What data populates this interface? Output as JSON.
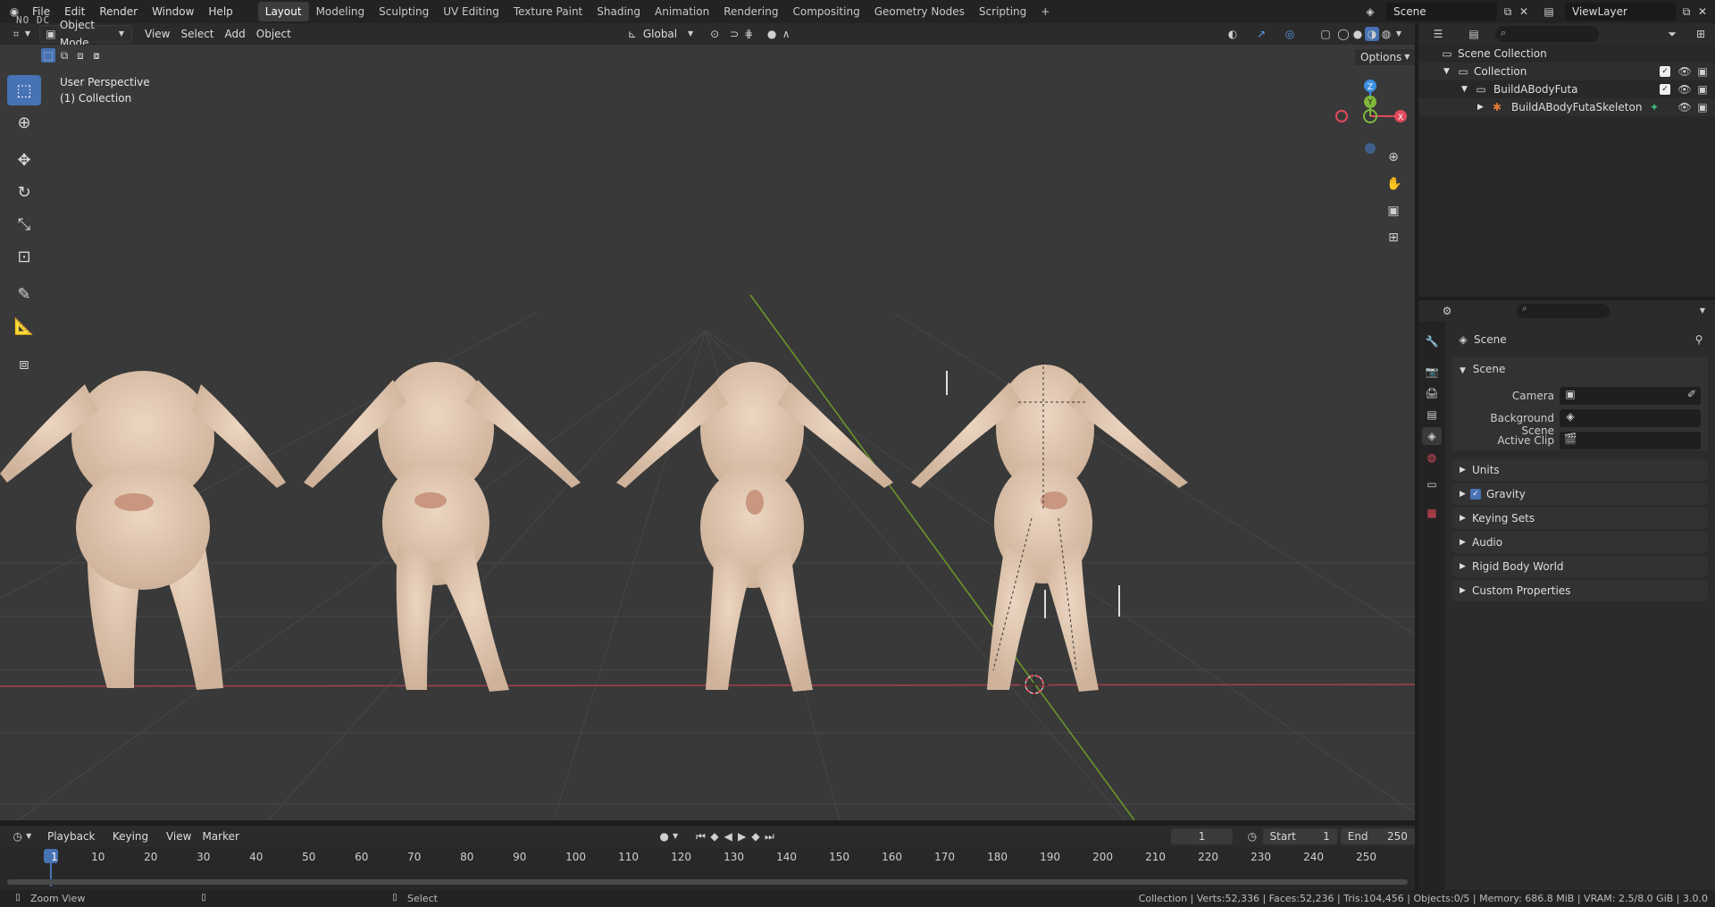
{
  "topbar": {
    "menus": [
      "File",
      "Edit",
      "Render",
      "Window",
      "Help"
    ],
    "workspaces": [
      "Layout",
      "Modeling",
      "Sculpting",
      "UV Editing",
      "Texture Paint",
      "Shading",
      "Animation",
      "Rendering",
      "Compositing",
      "Geometry Nodes",
      "Scripting"
    ],
    "active_workspace": "Layout",
    "add_label": "+",
    "scene_name": "Scene",
    "view_layer": "ViewLayer",
    "overlay_text": "NO DC"
  },
  "viewport_header": {
    "mode": "Object Mode",
    "menus": [
      "View",
      "Select",
      "Add",
      "Object"
    ],
    "transform_orientation": "Global",
    "options_label": "Options"
  },
  "viewport": {
    "perspective": "User Perspective",
    "collection": "(1) Collection",
    "gizmo_axes": [
      "Z",
      "Y",
      "X"
    ]
  },
  "outliner": {
    "search_placeholder": "",
    "rows": [
      {
        "label": "Scene Collection"
      },
      {
        "label": "Collection"
      },
      {
        "label": "BuildABodyFuta"
      },
      {
        "label": "BuildABodyFutaSkeleton"
      }
    ]
  },
  "properties": {
    "header": "Scene",
    "section": "Scene",
    "fields": [
      {
        "label": "Camera"
      },
      {
        "label": "Background Scene"
      },
      {
        "label": "Active Clip"
      }
    ],
    "panels": [
      "Units",
      "Gravity",
      "Keying Sets",
      "Audio",
      "Rigid Body World",
      "Custom Properties"
    ],
    "gravity_checked": true
  },
  "timeline": {
    "menus": [
      "Playback",
      "Keying",
      "View",
      "Marker"
    ],
    "current_frame": "1",
    "start_label": "Start",
    "start_value": "1",
    "end_label": "End",
    "end_value": "250",
    "ticks": [
      "1",
      "10",
      "20",
      "30",
      "40",
      "50",
      "60",
      "70",
      "80",
      "90",
      "100",
      "110",
      "120",
      "130",
      "140",
      "150",
      "160",
      "170",
      "180",
      "190",
      "200",
      "210",
      "220",
      "230",
      "240",
      "250"
    ]
  },
  "status": {
    "left_hint": "Zoom View",
    "mid_hint": "Select",
    "stats": "Collection | Verts:52,336 | Faces:52,236 | Tris:104,456 | Objects:0/5 | Memory: 686.8 MiB | VRAM: 2.5/8.0 GiB | 3.0.0"
  },
  "colors": {
    "accent": "#4772b3",
    "x_axis": "#e04a5b",
    "y_axis": "#7fb83a",
    "z_axis": "#3d8fe0",
    "skin": "#e3cbb4"
  }
}
